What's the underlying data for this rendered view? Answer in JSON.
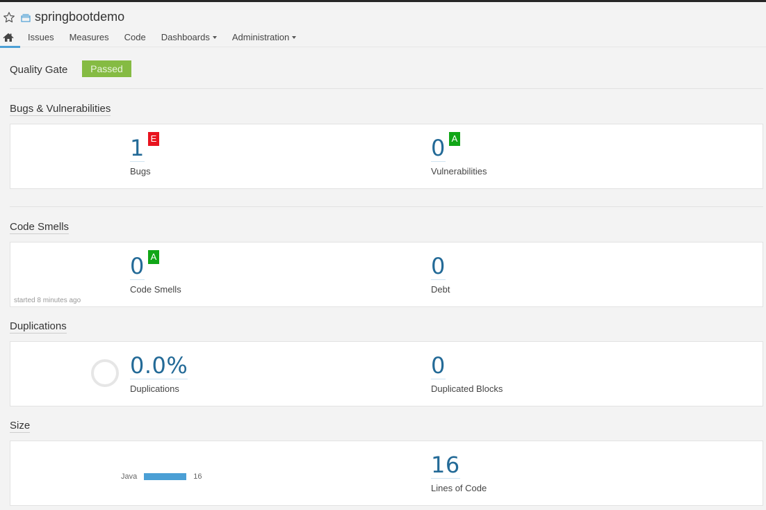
{
  "project": {
    "name": "springbootdemo",
    "star_icon": "star-outline-icon",
    "type_icon": "project-icon"
  },
  "nav": {
    "home_icon": "home-icon",
    "items": [
      {
        "label": "Issues",
        "dropdown": false
      },
      {
        "label": "Measures",
        "dropdown": false
      },
      {
        "label": "Code",
        "dropdown": false
      },
      {
        "label": "Dashboards",
        "dropdown": true
      },
      {
        "label": "Administration",
        "dropdown": true
      }
    ]
  },
  "quality_gate": {
    "label": "Quality Gate",
    "status": "Passed",
    "status_color": "#85bb43"
  },
  "sections": {
    "bugs_vulns": {
      "title": "Bugs & Vulnerabilities",
      "bugs": {
        "value": "1",
        "label": "Bugs",
        "rating": "E",
        "rating_color": "#e8141f"
      },
      "vulnerabilities": {
        "value": "0",
        "label": "Vulnerabilities",
        "rating": "A",
        "rating_color": "#11a617"
      }
    },
    "code_smells": {
      "title": "Code Smells",
      "smells": {
        "value": "0",
        "label": "Code Smells",
        "rating": "A",
        "rating_color": "#11a617"
      },
      "debt": {
        "value": "0",
        "label": "Debt"
      },
      "started": "started 8 minutes ago"
    },
    "duplications": {
      "title": "Duplications",
      "density": {
        "value": "0.0%",
        "label": "Duplications",
        "percent": 0.0
      },
      "blocks": {
        "value": "0",
        "label": "Duplicated Blocks"
      }
    },
    "size": {
      "title": "Size",
      "languages": [
        {
          "name": "Java",
          "value": "16",
          "fraction": 1.0
        }
      ],
      "loc": {
        "value": "16",
        "label": "Lines of Code"
      }
    }
  },
  "colors": {
    "accent": "#4b9fd5",
    "measure_value": "#236a97"
  }
}
